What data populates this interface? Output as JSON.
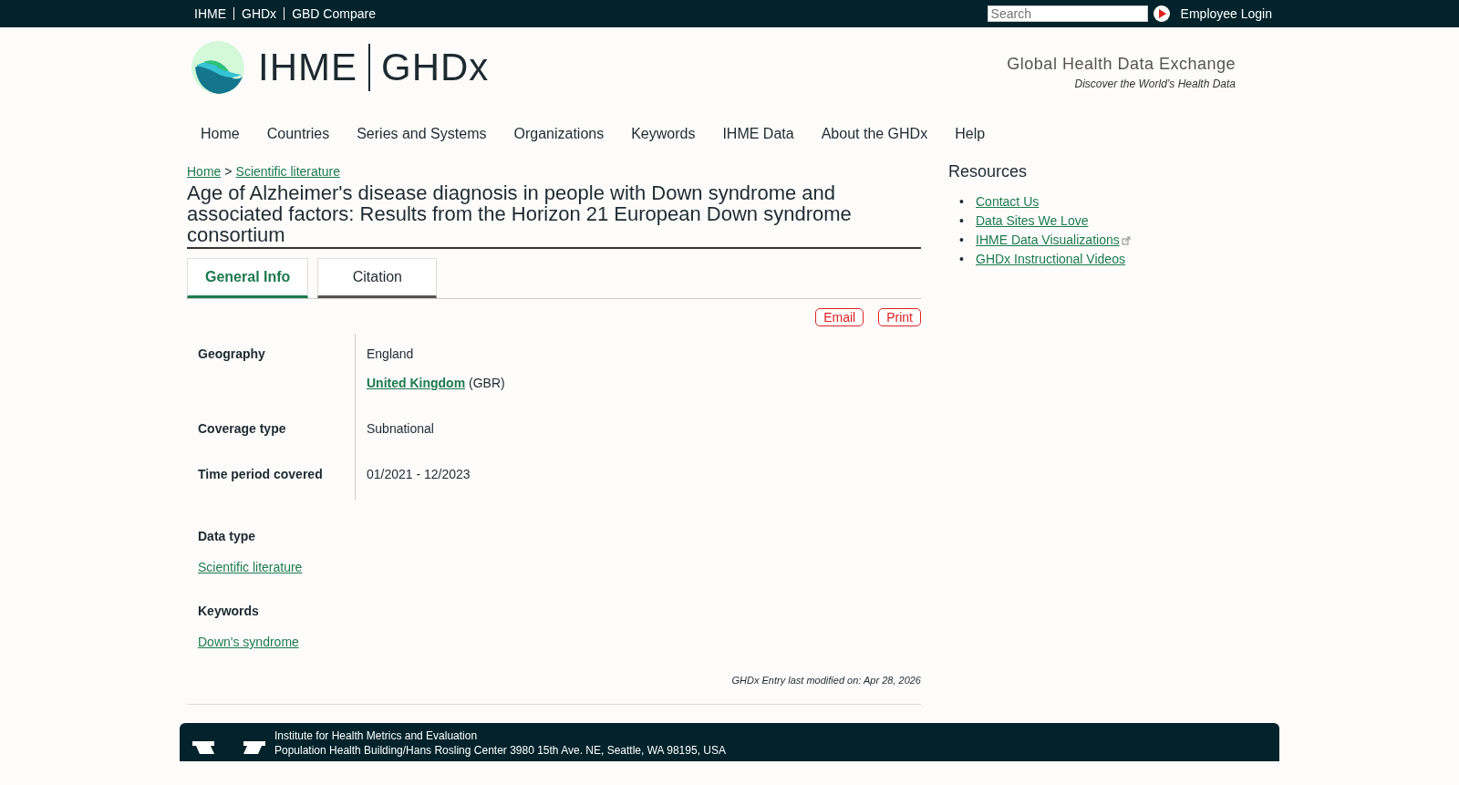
{
  "top_bar": {
    "links": [
      "IHME",
      "GHDx",
      "GBD Compare"
    ],
    "search": {
      "placeholder": "Search"
    },
    "login": "Employee Login"
  },
  "header": {
    "logo_left": "IHME",
    "logo_right": "GHDx",
    "tagline_title": "Global Health Data Exchange",
    "tagline_sub": "Discover the World’s Health Data"
  },
  "nav": [
    "Home",
    "Countries",
    "Series and Systems",
    "Organizations",
    "Keywords",
    "IHME Data",
    "About the GHDx",
    "Help"
  ],
  "breadcrumb": {
    "links": [
      "Home",
      "Scientific literature"
    ],
    "separator": ">"
  },
  "title": "Age of Alzheimer's disease diagnosis in people with Down syndrome and associated factors: Results from the Horizon 21 European Down syndrome consortium",
  "tabs": [
    {
      "label": "General Info",
      "selected": true
    },
    {
      "label": "Citation",
      "selected": false
    }
  ],
  "actions": [
    "Email",
    "Print"
  ],
  "fields": [
    {
      "label": "Geography",
      "values": [
        {
          "text": "England"
        },
        {
          "link": "United Kingdom",
          "suffix": "(GBR)"
        }
      ]
    },
    {
      "label": "Coverage type",
      "values": [
        {
          "text": "Subnational"
        }
      ]
    },
    {
      "label": "Time period covered",
      "values": [
        {
          "text": "01/2021 - 12/2023"
        }
      ]
    }
  ],
  "blocks": [
    {
      "label": "Data type",
      "link": "Scientific literature"
    },
    {
      "label": "Keywords",
      "link": "Down's syndrome"
    }
  ],
  "modified": "GHDx Entry last modified on: Apr 28, 2026",
  "resources": {
    "title": "Resources",
    "links": [
      {
        "marker": "•",
        "label": "Contact Us",
        "external": false
      },
      {
        "marker": "•",
        "label": "Data Sites We Love",
        "external": false
      },
      {
        "marker": "•",
        "label": "IHME Data Visualizations",
        "external": true
      },
      {
        "marker": "•",
        "label": "GHDx Instructional Videos",
        "external": false
      }
    ]
  },
  "footer": {
    "lines": [
      "Institute for Health Metrics and Evaluation",
      "Population Health Building/Hans Rosling Center 3980 15th Ave. NE, Seattle, WA 98195, USA"
    ]
  }
}
